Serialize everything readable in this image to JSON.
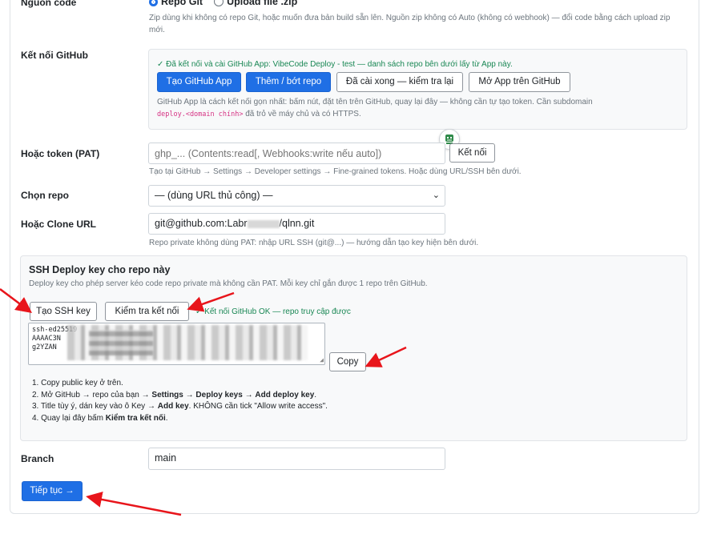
{
  "source": {
    "label": "Nguồn code",
    "option_git": "Repo Git",
    "option_zip": "Upload file .zip",
    "help": "Zip dùng khi không có repo Git, hoặc muốn đưa bản build sẵn lên. Nguồn zip không có Auto (không có webhook) — đổi code bằng cách upload zip mới."
  },
  "github": {
    "label": "Kết nối GitHub",
    "status": "✓ Đã kết nối và cài GitHub App: VibeCode Deploy - test — danh sách repo bên dưới lấy từ App này.",
    "btn_create_app": "Tạo GitHub App",
    "btn_add_remove": "Thêm / bớt repo",
    "btn_installed": "Đã cài xong — kiểm tra lại",
    "btn_open_app": "Mở App trên GitHub",
    "help_1": "GitHub App là cách kết nối gọn nhất: bấm nút, đặt tên trên GitHub, quay lại đây — không cần tự tạo token. Cần subdomain",
    "help_code": "deploy.<domain chính>",
    "help_2": "đã trỏ về máy chủ và có HTTPS."
  },
  "token": {
    "label": "Hoặc token (PAT)",
    "placeholder": "ghp_... (Contents:read[, Webhooks:write nếu auto])",
    "btn_connect": "Kết nối",
    "help": "Tạo tại GitHub → Settings → Developer settings → Fine-grained tokens. Hoặc dùng URL/SSH bên dưới."
  },
  "repo": {
    "label": "Chọn repo",
    "selected": "— (dùng URL thủ công) —"
  },
  "clone": {
    "label": "Hoặc Clone URL",
    "value_a": "git@github.com:Labr",
    "value_b": "/qlnn.git",
    "help": "Repo private không dùng PAT: nhập URL SSH (git@...) — hướng dẫn tạo key hiện bên dưới."
  },
  "ssh": {
    "title": "SSH Deploy key cho repo này",
    "subtitle": "Deploy key cho phép server kéo code repo private mà không cần PAT. Mỗi key chỉ gắn được 1 repo trên GitHub.",
    "btn_create": "Tạo SSH key",
    "btn_check": "Kiểm tra kết nối",
    "status": "✓ Kết nối GitHub OK — repo truy cập được",
    "key_line1": "ssh-ed25519",
    "key_line2": "AAAAC3N",
    "key_line3": "g2YZAN",
    "btn_copy": "Copy",
    "step1": "1. Copy public key ở trên.",
    "step2_a": "2. Mở GitHub → repo của bạn →",
    "step2_b": "Settings",
    "step2_c": "→",
    "step2_d": "Deploy keys",
    "step2_e": "→",
    "step2_f": "Add deploy key",
    "step3_a": "3. Title tùy ý, dán key vào ô Key →",
    "step3_b": "Add key",
    "step3_c": ". KHÔNG cần tick \"Allow write access\".",
    "step4_a": "4. Quay lại đây bấm",
    "step4_b": "Kiểm tra kết nối",
    "step4_c": "."
  },
  "branch": {
    "label": "Branch",
    "value": "main"
  },
  "continue_button": "Tiếp tục →",
  "colors": {
    "primary": "#1f6fe5",
    "success": "#198754",
    "annotation_arrow": "#e8151b"
  }
}
